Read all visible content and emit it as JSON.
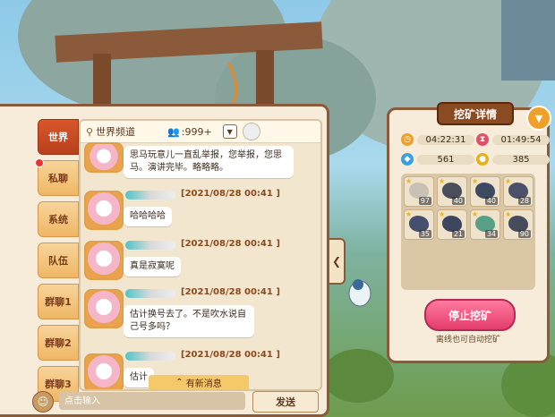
{
  "chat": {
    "tabs": [
      {
        "label": "世界",
        "active": true
      },
      {
        "label": "私聊",
        "dot": true
      },
      {
        "label": "系统"
      },
      {
        "label": "队伍"
      },
      {
        "label": "群聊1"
      },
      {
        "label": "群聊2"
      },
      {
        "label": "群聊3"
      }
    ],
    "channel": {
      "name": "世界频道",
      "count": ":999+"
    },
    "top_bubble": "思马玩意儿一直乱举报，您举报，您思马。演讲完毕。略略略。",
    "messages": [
      {
        "time": "[2021/08/28 00:41 ]",
        "text": "哈哈哈哈"
      },
      {
        "time": "[2021/08/28 00:41 ]",
        "text": "真是寂寞呢"
      },
      {
        "time": "[2021/08/28 00:41 ]",
        "text": "估计换号去了。不是吹水说自己号多吗？"
      },
      {
        "time": "[2021/08/28 00:41 ]",
        "text": "估计"
      }
    ],
    "new_msg": "有新消息",
    "input_placeholder": "点击输入",
    "send_label": "发送"
  },
  "mining": {
    "title": "挖矿详情",
    "timer1": "04:22:31",
    "timer2": "01:49:54",
    "gems": "561",
    "gold": "385",
    "ores": [
      {
        "qty": "97",
        "color": "#c9c1b4"
      },
      {
        "qty": "40",
        "color": "#4a4e5a"
      },
      {
        "qty": "40",
        "color": "#3e4a62"
      },
      {
        "qty": "28",
        "color": "#4b5168"
      },
      {
        "qty": "35",
        "color": "#44506e"
      },
      {
        "qty": "21",
        "color": "#3d465e"
      },
      {
        "qty": "34",
        "color": "#5aa088"
      },
      {
        "qty": "90",
        "color": "#474c5c"
      }
    ],
    "stop_label": "停止挖矿",
    "offline_note": "离线也可自动挖矿"
  },
  "colors": {
    "panel": "#f6ecd9",
    "border": "#8a5a3a",
    "accent": "#e43c6b",
    "tab_active": "#c84a22"
  }
}
